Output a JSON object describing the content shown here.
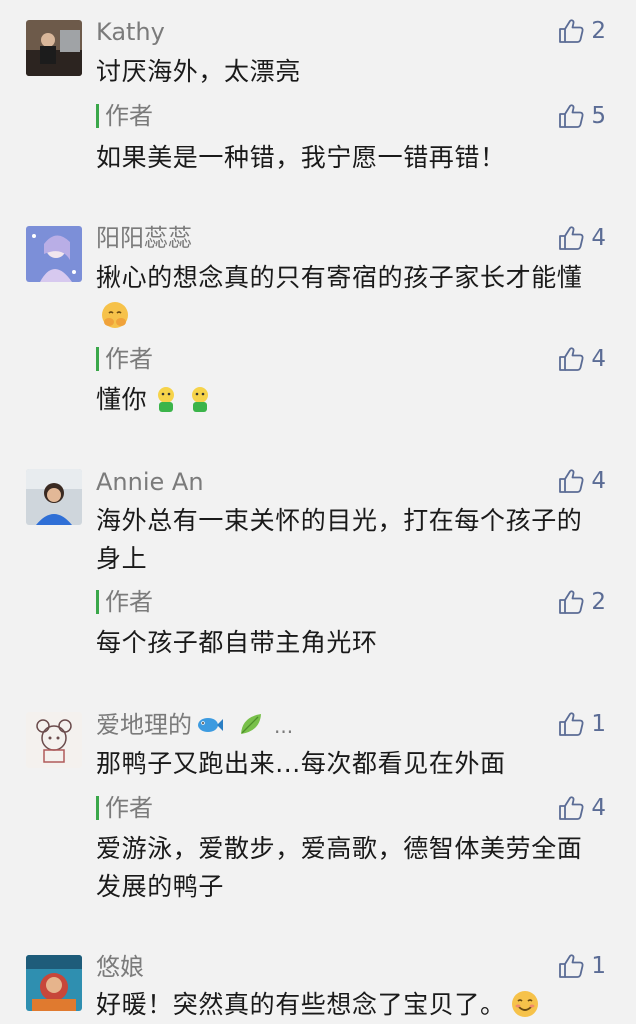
{
  "comments": [
    {
      "name": "Kathy",
      "text": "讨厌海外，太漂亮",
      "likes": "2",
      "reply": {
        "label": "作者",
        "text": "如果美是一种错，我宁愿一错再错！",
        "likes": "5"
      }
    },
    {
      "name": "阳阳蕊蕊",
      "text": "揪心的想念真的只有寄宿的孩子家长才能懂",
      "likes": "4",
      "reply": {
        "label": "作者",
        "text": "懂你",
        "likes": "4"
      }
    },
    {
      "name": "Annie An",
      "text": "海外总有一束关怀的目光，打在每个孩子的身上",
      "likes": "4",
      "reply": {
        "label": "作者",
        "text": "每个孩子都自带主角光环",
        "likes": "2"
      }
    },
    {
      "name": "爱地理的",
      "name_suffix": "...",
      "text": "那鸭子又跑出来...每次都看见在外面",
      "likes": "1",
      "reply": {
        "label": "作者",
        "text": "爱游泳，爱散步，爱高歌，德智体美劳全面发展的鸭子",
        "likes": "4"
      }
    },
    {
      "name": "悠娘",
      "text": "好暖！突然真的有些想念了宝贝了。",
      "likes": "1"
    }
  ],
  "icons": {
    "like": "thumbs-up-icon",
    "emoji_face": "hands-face-emoji",
    "emoji_green": "green-person-emoji",
    "emoji_fish": "fish-emoji",
    "emoji_leaf": "leaf-emoji",
    "emoji_smile": "smile-emoji"
  },
  "colors": {
    "background": "#f2f2f2",
    "author_bar": "#3aa74a",
    "like_count": "#5b6c95",
    "name": "#7b7b7b"
  }
}
